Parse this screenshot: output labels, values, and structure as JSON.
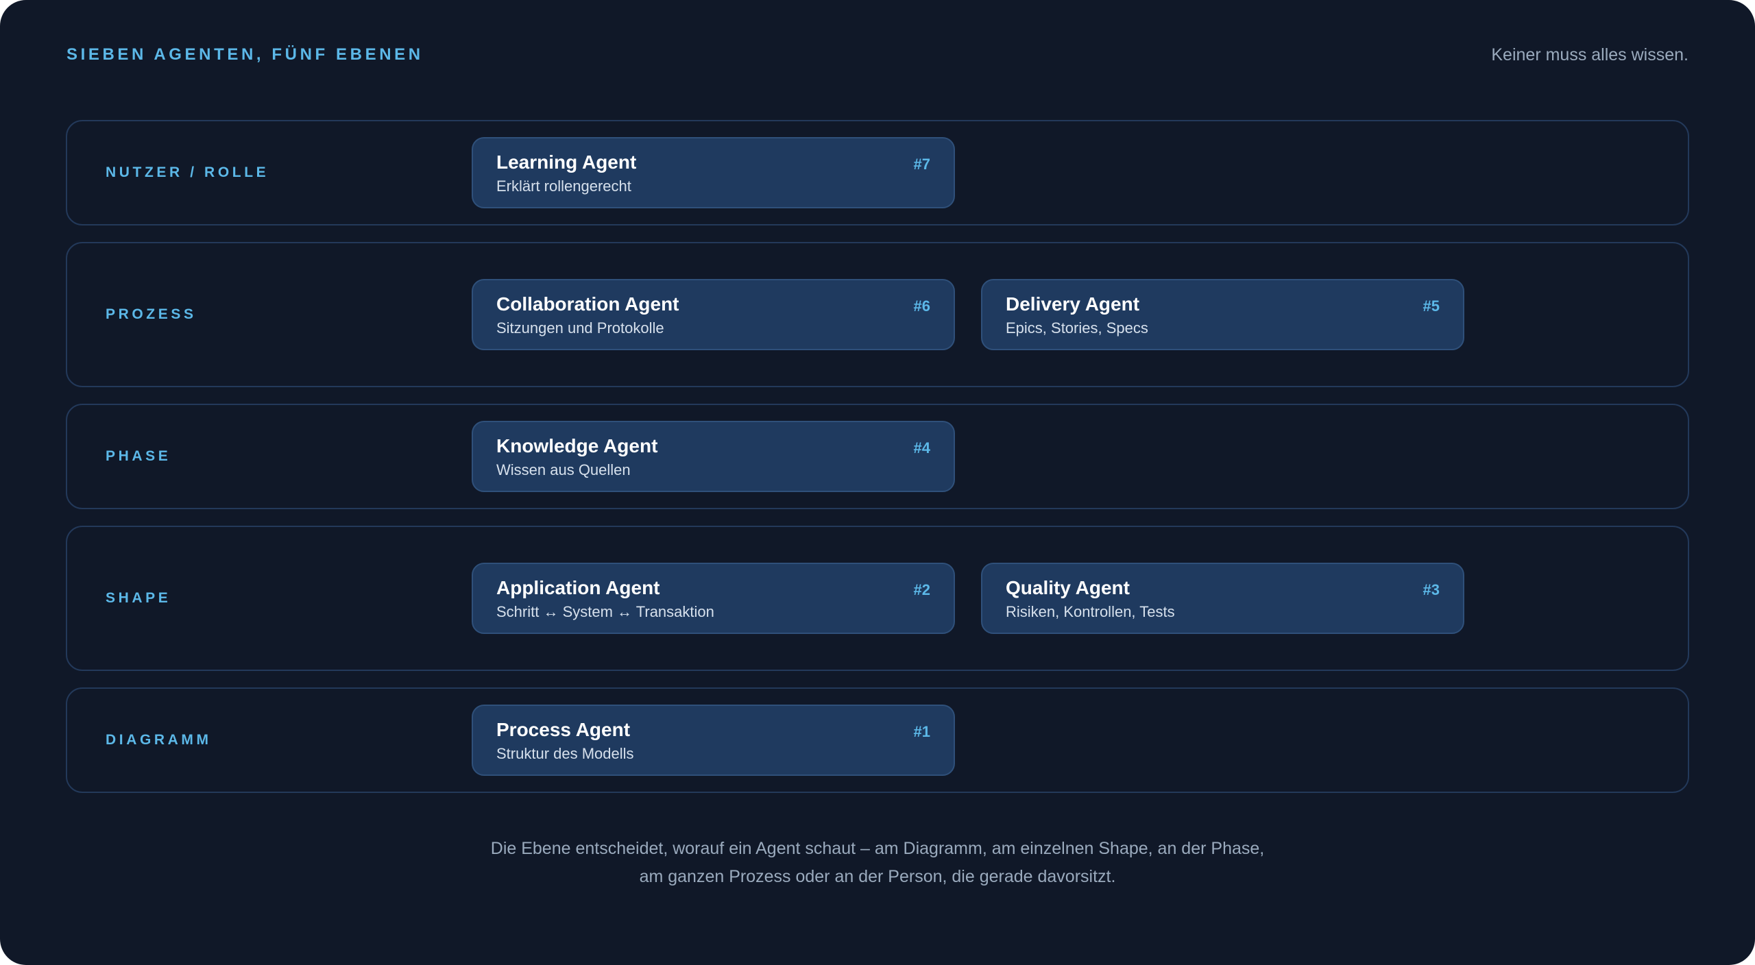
{
  "header": {
    "title": "SIEBEN AGENTEN, FÜNF EBENEN",
    "subtitle": "Keiner muss alles wissen."
  },
  "layers": [
    {
      "label": "NUTZER / ROLLE",
      "agents": [
        {
          "name": "Learning Agent",
          "description": "Erklärt rollengerecht",
          "number": "#7"
        }
      ]
    },
    {
      "label": "PROZESS",
      "agents": [
        {
          "name": "Collaboration Agent",
          "description": "Sitzungen und Protokolle",
          "number": "#6"
        },
        {
          "name": "Delivery Agent",
          "description": "Epics, Stories, Specs",
          "number": "#5"
        }
      ]
    },
    {
      "label": "PHASE",
      "agents": [
        {
          "name": "Knowledge Agent",
          "description": "Wissen aus Quellen",
          "number": "#4"
        }
      ]
    },
    {
      "label": "SHAPE",
      "agents": [
        {
          "name": "Application Agent",
          "description": "Schritt ↔ System ↔ Transaktion",
          "number": "#2"
        },
        {
          "name": "Quality Agent",
          "description": "Risiken, Kontrollen, Tests",
          "number": "#3"
        }
      ]
    },
    {
      "label": "DIAGRAMM",
      "agents": [
        {
          "name": "Process Agent",
          "description": "Struktur des Modells",
          "number": "#1"
        }
      ]
    }
  ],
  "footer": {
    "line1": "Die Ebene entscheidet, worauf ein Agent schaut – am Diagramm, am einzelnen Shape, an der Phase,",
    "line2": "am ganzen Prozess oder an der Person, die gerade davorsitzt."
  },
  "colors": {
    "background": "#101828",
    "accent": "#5cb8e8",
    "card": "#1f3a5f",
    "border": "#23395a"
  }
}
